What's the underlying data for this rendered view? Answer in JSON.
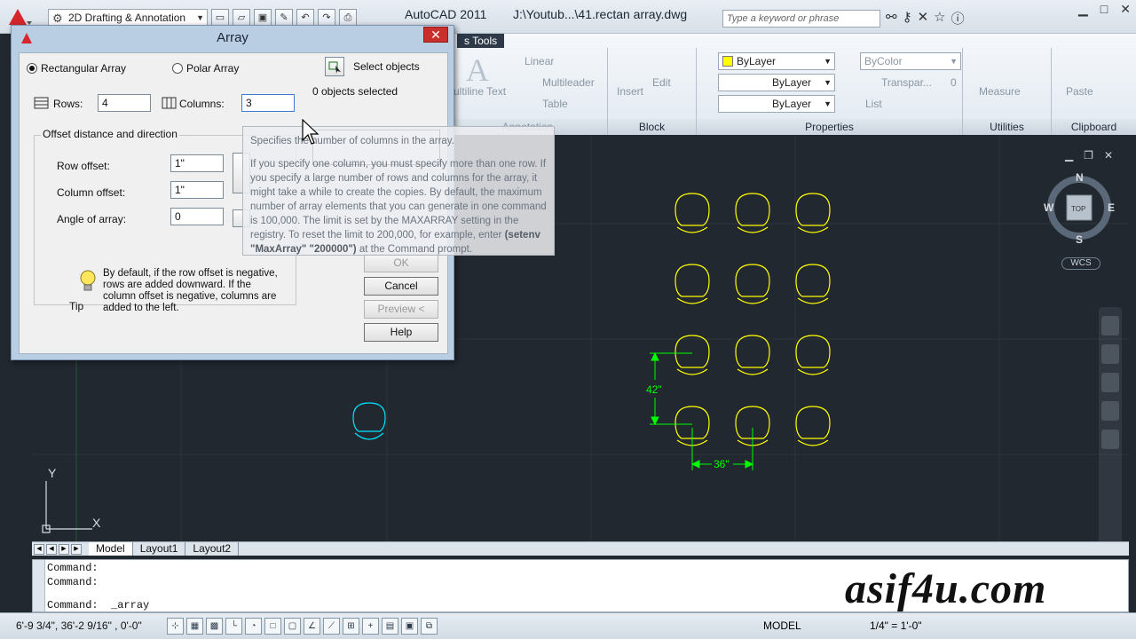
{
  "titlebar": {
    "workspace": "2D Drafting & Annotation",
    "app_title": "AutoCAD 2011",
    "doc_title": "J:\\Youtub...\\41.rectan array.dwg",
    "search_placeholder": "Type a keyword or phrase"
  },
  "ribbon": {
    "tab_label": "s Tools",
    "annotation": {
      "multiline_text": "ultiline Text",
      "linear": "Linear",
      "multileader": "Multileader",
      "table": "Table",
      "title": "Annotation"
    },
    "block": {
      "insert": "Insert",
      "edit": "Edit",
      "title": "Block"
    },
    "properties": {
      "color": "ByLayer",
      "linetype": "ByLayer",
      "lineweight": "ByLayer",
      "plot_color": "ByColor",
      "transparency": "Transpar...",
      "transparency_value": "0",
      "list": "List",
      "title": "Properties"
    },
    "utilities": {
      "measure": "Measure",
      "title": "Utilities"
    },
    "clipboard": {
      "paste": "Paste",
      "title": "Clipboard"
    }
  },
  "dialog": {
    "title": "Array",
    "rect_array": "Rectangular Array",
    "polar_array": "Polar Array",
    "select_objects": "Select objects",
    "objects_selected": "0 objects selected",
    "rows_label": "Rows:",
    "rows_value": "4",
    "columns_label": "Columns:",
    "columns_value": "3",
    "offset_group": "Offset distance and direction",
    "row_offset_label": "Row offset:",
    "row_offset_value": "1\"",
    "col_offset_label": "Column offset:",
    "col_offset_value": "1\"",
    "angle_label": "Angle of array:",
    "angle_value": "0",
    "tip_text": "By default, if the row offset is negative, rows are added downward.  If the column offset is negative, columns are added to the left.",
    "tip_label": "Tip",
    "ok": "OK",
    "cancel": "Cancel",
    "preview": "Preview <",
    "help": "Help"
  },
  "tooltip": {
    "line1": "Specifies the number of columns in the array.",
    "line2": "If you specify one column, you must specify more than one row. If you specify a large number of rows and columns for the array, it might take a while to create the copies. By default, the maximum number of array elements that you can generate in one command is 100,000. The limit is set by the MAXARRAY setting in the registry. To reset the limit to 200,000, for example, enter",
    "cmd": "(setenv \"MaxArray\" \"200000\")",
    "line3": "at the Command prompt."
  },
  "viewcube": {
    "n": "N",
    "s": "S",
    "e": "E",
    "w": "W",
    "top": "TOP",
    "wcs": "WCS"
  },
  "drawing": {
    "dim_vertical": "42\"",
    "dim_horizontal": "36\"",
    "ucs_y": "Y",
    "ucs_x": "X",
    "line_color": "#ffff00",
    "selected_color": "#00e5ff",
    "dim_color": "#00ff00"
  },
  "layout_tabs": [
    "Model",
    "Layout1",
    "Layout2"
  ],
  "command": {
    "lines": [
      "Command:",
      "Command:",
      "Command:  _array"
    ]
  },
  "watermark": "asif4u.com",
  "status": {
    "coords": "6'-9 3/4\",   36'-2 9/16\" , 0'-0\"",
    "model": "MODEL",
    "scale": "1/4\" = 1'-0\""
  }
}
